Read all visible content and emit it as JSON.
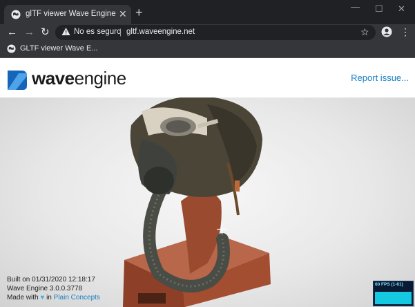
{
  "browser": {
    "tab": {
      "title": "glTF viewer Wave Engine",
      "favicon": "globe-icon"
    },
    "address_bar": {
      "security_label": "No es seguro",
      "url": "gltf.waveengine.net"
    },
    "bookmarks": [
      {
        "label": "GLTF viewer Wave E..."
      }
    ]
  },
  "page": {
    "logo": {
      "word1": "wave",
      "word2": "engine"
    },
    "report_link": "Report issue...",
    "info": {
      "built_on": "Built on 01/31/2020 12:18:17",
      "version": "Wave Engine 3.0.0.3778",
      "made_with_prefix": "Made with",
      "made_with_in": "in",
      "made_with_link": "Plain Concepts"
    },
    "fps_overlay": {
      "label": "60 FPS (1-61)"
    }
  },
  "colors": {
    "accent": "#1a7fc4",
    "fps_bar": "#13c8e0",
    "chrome_dark": "#202124",
    "chrome_mid": "#35363a"
  }
}
